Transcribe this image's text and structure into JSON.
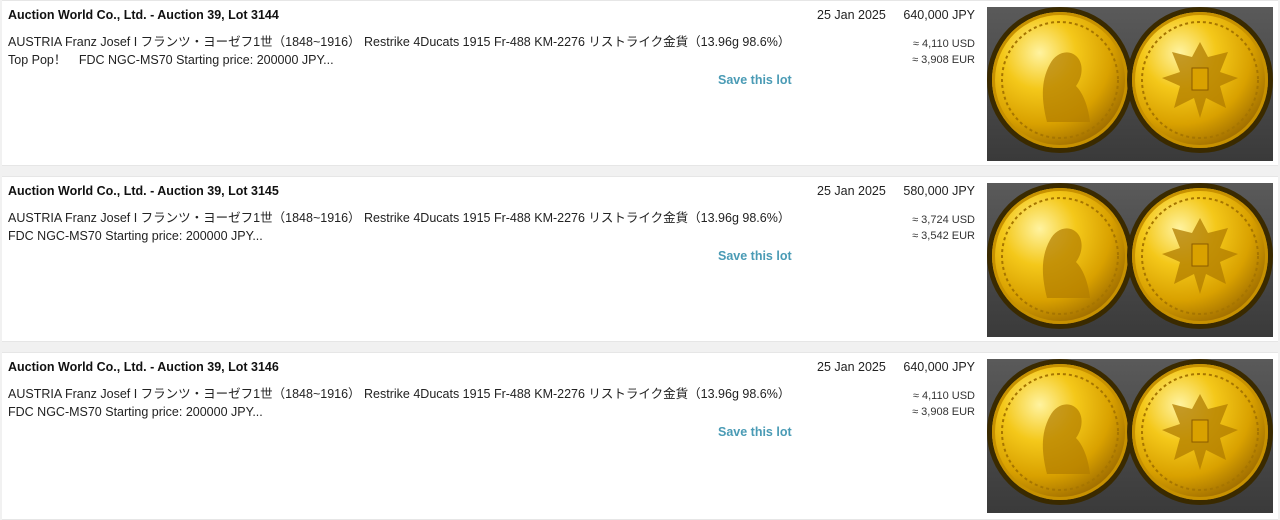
{
  "lots": [
    {
      "title": "Auction World Co., Ltd. - Auction 39, Lot 3144",
      "description": "AUSTRIA Franz Josef I フランツ・ヨーゼフ1世（1848~1916） Restrike 4Ducats 1915 Fr-488 KM-2276 リストライク金貨（13.96g 98.6%）Top Pop！　FDC NGC-MS70 Starting price: 200000 JPY...",
      "date": "25 Jan 2025",
      "price": "640,000 JPY",
      "usd": "≈ 4,110 USD",
      "eur": "≈ 3,908 EUR",
      "save_label": "Save this lot"
    },
    {
      "title": "Auction World Co., Ltd. - Auction 39, Lot 3145",
      "description": "AUSTRIA Franz Josef I フランツ・ヨーゼフ1世（1848~1916） Restrike 4Ducats 1915 Fr-488 KM-2276 リストライク金貨（13.96g 98.6%）　　FDC NGC-MS70 Starting price: 200000 JPY...",
      "date": "25 Jan 2025",
      "price": "580,000 JPY",
      "usd": "≈ 3,724 USD",
      "eur": "≈ 3,542 EUR",
      "save_label": "Save this lot"
    },
    {
      "title": "Auction World Co., Ltd. - Auction 39, Lot 3146",
      "description": "AUSTRIA Franz Josef I フランツ・ヨーゼフ1世（1848~1916） Restrike 4Ducats 1915 Fr-488 KM-2276 リストライク金貨（13.96g 98.6%）　　FDC NGC-MS70 Starting price: 200000 JPY...",
      "date": "25 Jan 2025",
      "price": "640,000 JPY",
      "usd": "≈ 4,110 USD",
      "eur": "≈ 3,908 EUR",
      "save_label": "Save this lot"
    }
  ],
  "thumbnail": {
    "obverse_icon": "coin-portrait-icon",
    "reverse_icon": "double-eagle-icon",
    "colors": {
      "gold": "#e9b80c",
      "slab": "#3f3f3f"
    }
  }
}
